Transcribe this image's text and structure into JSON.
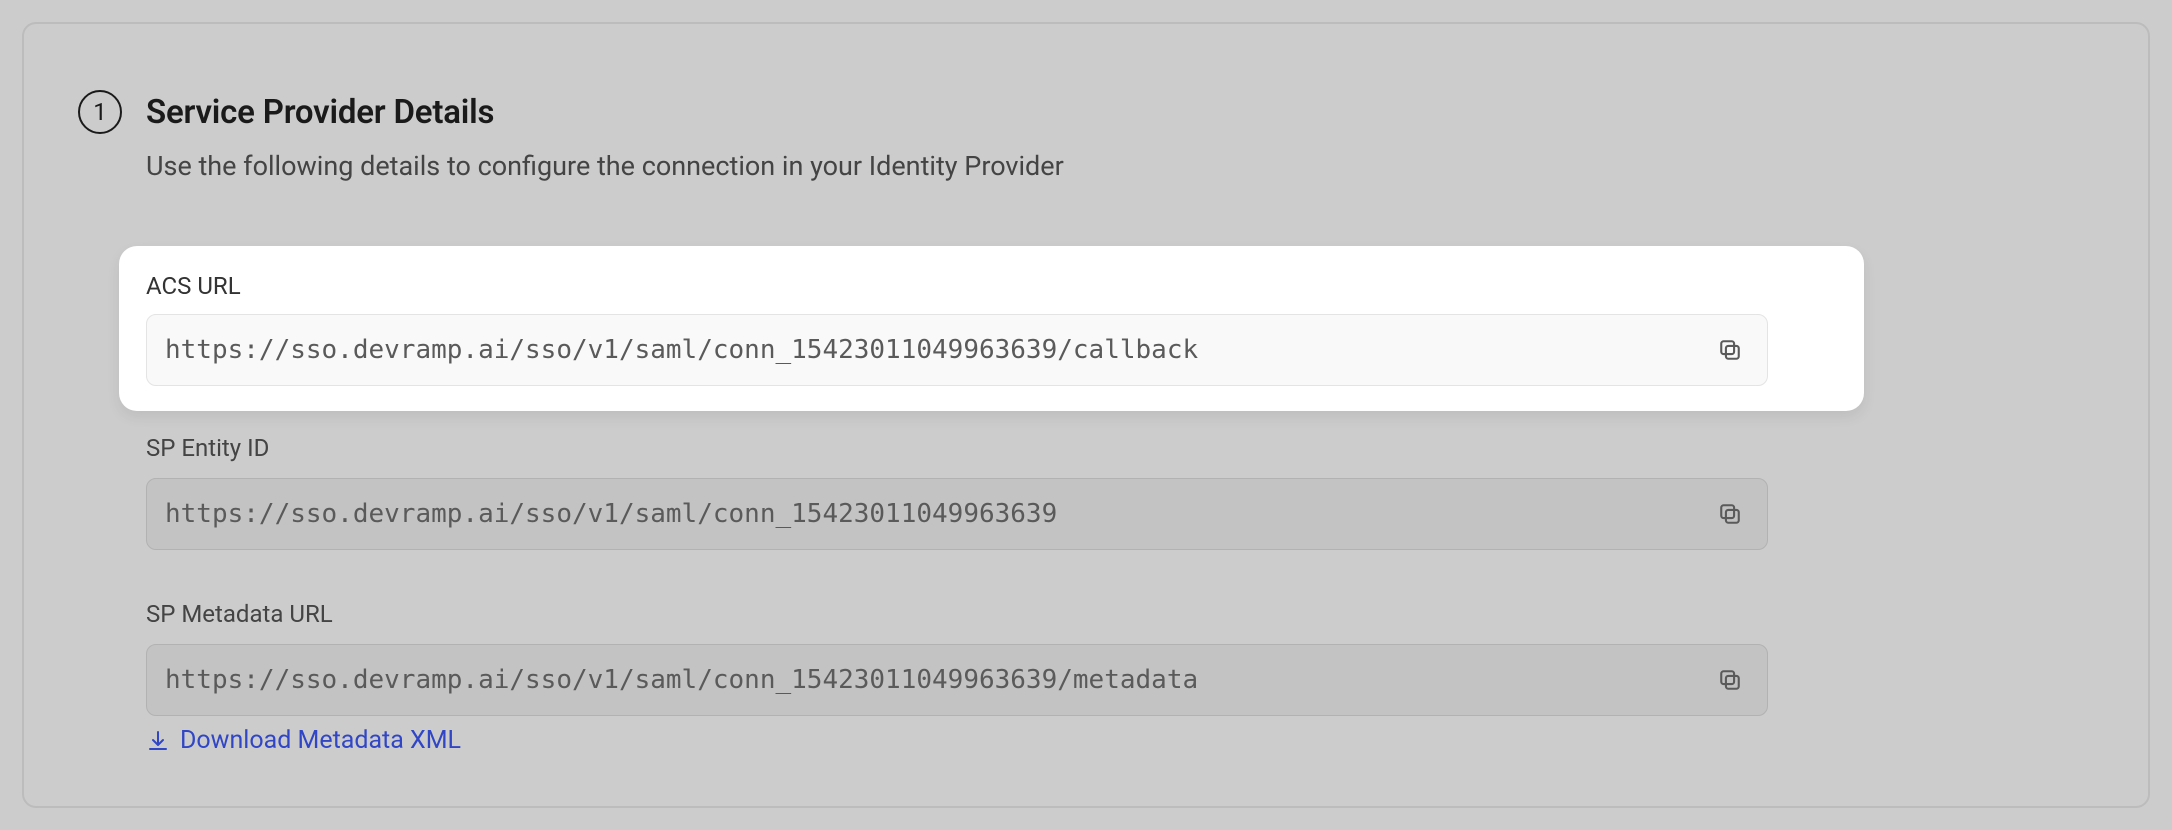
{
  "step": {
    "number": "1",
    "title": "Service Provider Details",
    "subtitle": "Use the following details to configure the connection in your Identity Provider"
  },
  "fields": {
    "acs": {
      "label": "ACS URL",
      "value": "https://sso.devramp.ai/sso/v1/saml/conn_15423011049963639/callback"
    },
    "entity": {
      "label": "SP Entity ID",
      "value": "https://sso.devramp.ai/sso/v1/saml/conn_15423011049963639"
    },
    "metadata": {
      "label": "SP Metadata URL",
      "value": "https://sso.devramp.ai/sso/v1/saml/conn_15423011049963639/metadata"
    }
  },
  "download_link": "Download Metadata XML",
  "icons": {
    "copy": "copy-icon",
    "download": "download-icon"
  }
}
